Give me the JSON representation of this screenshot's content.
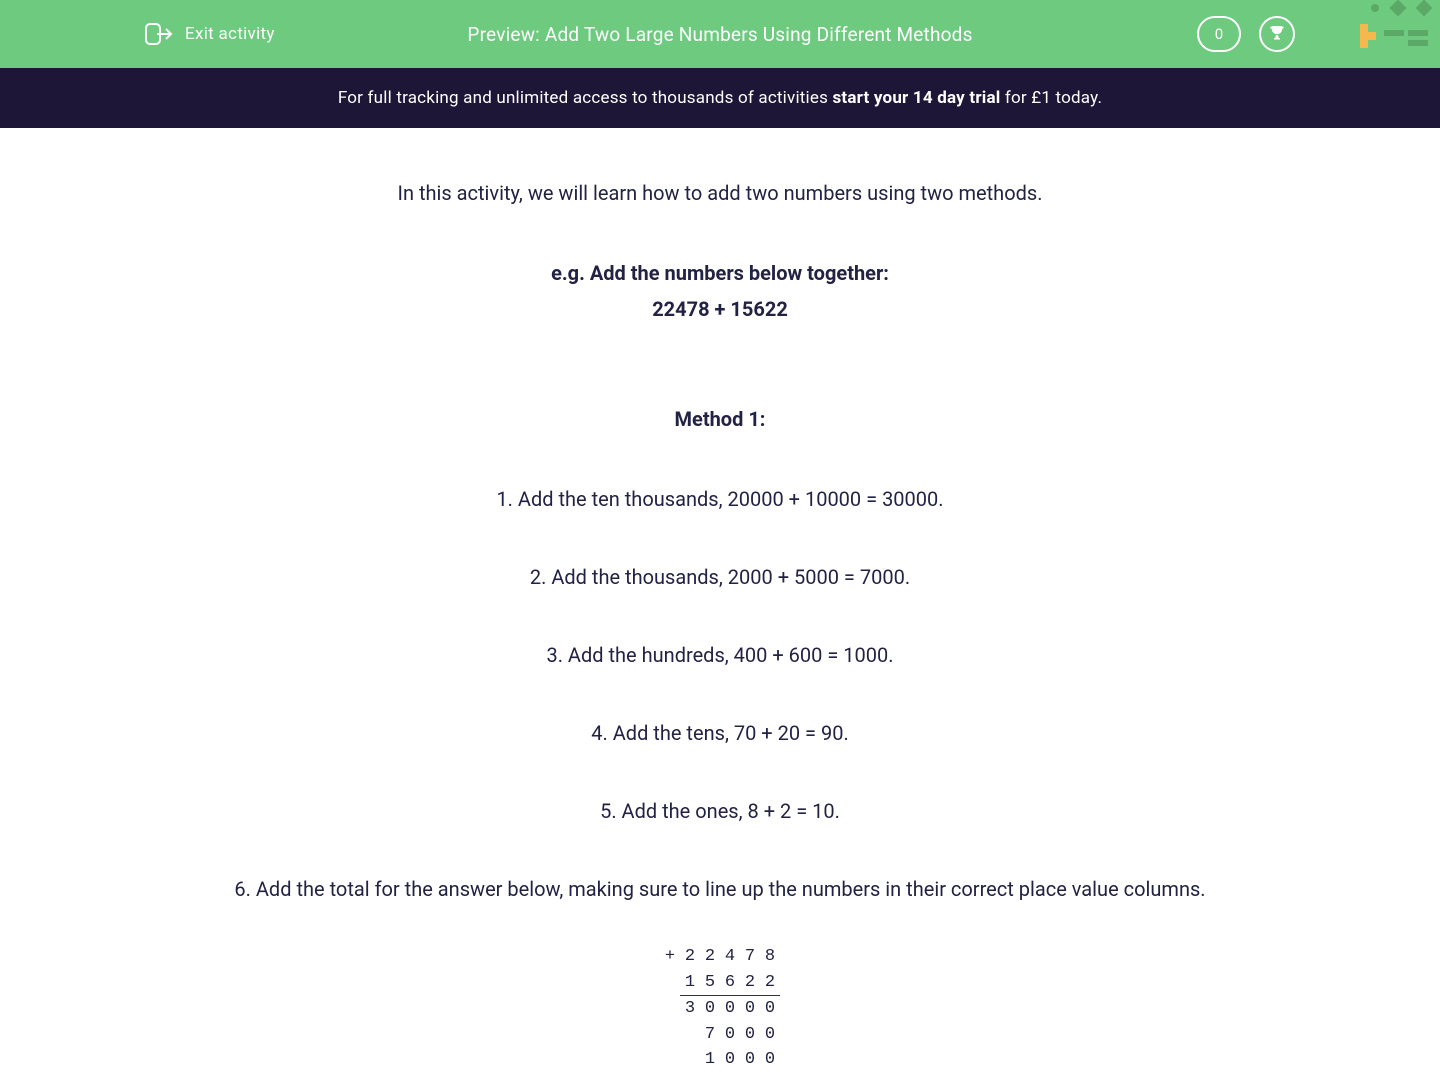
{
  "header": {
    "exit_label": "Exit activity",
    "title": "Preview: Add Two Large Numbers Using Different Methods",
    "score": "0"
  },
  "banner": {
    "prefix": "For full tracking and unlimited access to thousands of activities ",
    "strong": "start your 14 day trial",
    "suffix": " for £1 today."
  },
  "content": {
    "intro": "In this activity, we will learn how to add two numbers using two methods.",
    "example_heading": "e.g. Add the numbers below together:",
    "example_numbers": "22478 + 15622",
    "method1_heading": "Method 1:",
    "steps": {
      "s1": "1. Add the ten thousands, 20000 + 10000 = 30000.",
      "s2": "2. Add the thousands, 2000 + 5000 = 7000.",
      "s3": "3. Add the hundreds, 400 + 600 = 1000.",
      "s4": "4. Add the tens, 70 + 20 = 90.",
      "s5": "5. Add the ones, 8 + 2 = 10.",
      "s6": "6. Add the total for the answer below, making sure to line up the numbers in their correct place value columns."
    },
    "calc": {
      "r1": {
        "c0": "+",
        "c1": "2",
        "c2": "2",
        "c3": "4",
        "c4": "7",
        "c5": "8"
      },
      "r2": {
        "c0": "",
        "c1": "1",
        "c2": "5",
        "c3": "6",
        "c4": "2",
        "c5": "2"
      },
      "r3": {
        "c0": "",
        "c1": "3",
        "c2": "0",
        "c3": "0",
        "c4": "0",
        "c5": "0"
      },
      "r4": {
        "c0": "",
        "c1": "",
        "c2": "7",
        "c3": "0",
        "c4": "0",
        "c5": "0"
      },
      "r5": {
        "c0": "",
        "c1": "",
        "c2": "1",
        "c3": "0",
        "c4": "0",
        "c5": "0"
      }
    }
  }
}
